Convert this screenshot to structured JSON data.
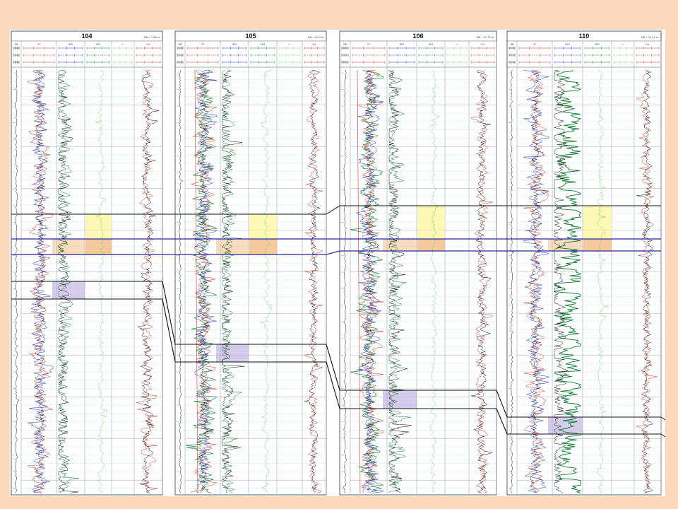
{
  "panel": {
    "background": "#ffffff",
    "page_background": "#fbd9bd"
  },
  "colors": {
    "gr": "#111111",
    "sp": "#c0392b",
    "res": "#2035c8",
    "den": "#0f7a2f",
    "green_light": "#7fc97f",
    "grid_dash": "#8fd0e8",
    "grid_major": "#9aa9b8",
    "marker_black": "#111111",
    "marker_blue": "#2c2a9c",
    "zone_yellow": "#fff59e",
    "zone_orange": "#f3c08a",
    "zone_purple": "#b9a8de"
  },
  "wells": [
    {
      "name": "104",
      "kb": "KB = 7.08 m"
    },
    {
      "name": "105",
      "kb": "KB = 10.9 m"
    },
    {
      "name": "106",
      "kb": "KB = 12.73 m"
    },
    {
      "name": "110",
      "kb": "KB = 11.47 m"
    }
  ],
  "track_headers": {
    "gr": "GR",
    "sp": "SP",
    "res": "RES",
    "den": "DEN",
    "ac": "AC",
    "cal": "CAL"
  },
  "correlation_markers": [
    {
      "id": "marker-1",
      "color": "black"
    },
    {
      "id": "marker-2",
      "color": "blue"
    },
    {
      "id": "marker-3",
      "color": "blue"
    },
    {
      "id": "marker-4",
      "color": "black"
    },
    {
      "id": "marker-5",
      "color": "black"
    }
  ],
  "highlight_zones": [
    "yellow",
    "orange",
    "purple"
  ]
}
